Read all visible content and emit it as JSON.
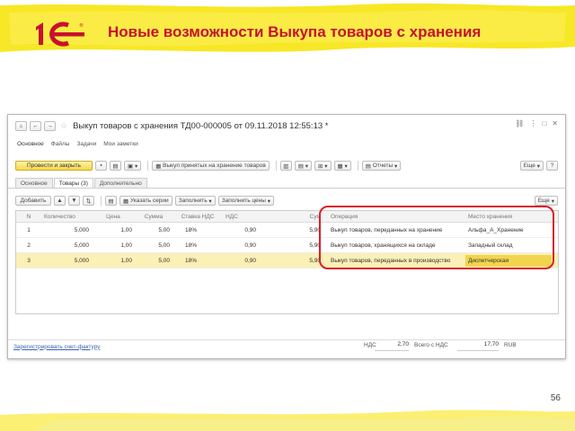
{
  "slide": {
    "title": "Новые возможности Выкупа товаров с хранения",
    "page_number": "56",
    "logo_text": "1С",
    "logo_color": "#c8102e",
    "band_color": "#f7e300"
  },
  "window": {
    "title": "Выкуп товаров с хранения ТД00-000005 от 09.11.2018 12:55:13 *",
    "nav": [
      "Основное",
      "Файлы",
      "Задачи",
      "Мои заметки"
    ],
    "cmd": {
      "post_close": "Провести и закрыть",
      "buyback": "Выкуп принятых на хранение товаров",
      "reports": "Отчеты",
      "more": "Еще",
      "help": "?"
    },
    "tabs": [
      "Основное",
      "Товары (3)",
      "Дополнительно"
    ],
    "table_bar": {
      "add": "Добавить",
      "specify_series": "Указать серии",
      "fill": "Заполнить",
      "fill_prices": "Заполнить цены",
      "more": "Еще"
    },
    "table": {
      "columns": [
        "N",
        "Количество",
        "Цена",
        "Сумма",
        "Ставка НДС",
        "НДС",
        "Сум",
        "Операция",
        "Место хранения"
      ],
      "rows": [
        [
          "1",
          "5,000",
          "1,00",
          "5,00",
          "18%",
          "0,90",
          "5,90",
          "Выкуп товаров, переданных на хранение",
          "Альфа_А_Хранение"
        ],
        [
          "2",
          "5,000",
          "1,00",
          "5,00",
          "18%",
          "0,90",
          "5,90",
          "Выкуп товаров, хранящихся на складе",
          "Западный склад"
        ],
        [
          "3",
          "5,000",
          "1,00",
          "5,00",
          "18%",
          "0,90",
          "5,90",
          "Выкуп товаров, переданных в производство",
          "Диспетчерская"
        ]
      ],
      "selected_row": 2
    },
    "footer": {
      "register_invoice": "Зарегистрировать счет-фактуру",
      "vat_label": "НДС",
      "vat_value": "2,70",
      "total_label": "Всего с НДС",
      "total_value": "17,70",
      "currency": "RUB"
    }
  }
}
